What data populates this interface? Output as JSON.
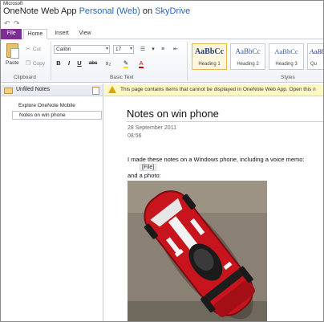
{
  "app": {
    "brand_small": "Microsoft",
    "app_name": "OneNote Web App",
    "notebook_name": "Personal (Web)",
    "on_text": "on",
    "service": "SkyDrive"
  },
  "quick_access": {
    "undo_glyph": "↶",
    "redo_glyph": "↷"
  },
  "tabs": [
    {
      "label": "File"
    },
    {
      "label": "Home"
    },
    {
      "label": "Insert"
    },
    {
      "label": "View"
    }
  ],
  "ribbon": {
    "clipboard": {
      "paste_label": "Paste",
      "cut_label": "Cut",
      "copy_label": "Copy",
      "group_label": "Clipboard"
    },
    "basic_text": {
      "font_name": "Calibri",
      "font_size": "17",
      "bold": "B",
      "italic": "I",
      "underline": "U",
      "strike": "abc",
      "group_label": "Basic Text"
    },
    "styles": {
      "group_label": "Styles",
      "items": [
        {
          "sample": "AaBbCc",
          "name": "Heading 1"
        },
        {
          "sample": "AaBbCc",
          "name": "Heading 2"
        },
        {
          "sample": "AaBbCc",
          "name": "Heading 3"
        },
        {
          "sample": "AaBbCc",
          "name": "Qu"
        }
      ]
    }
  },
  "navigation": {
    "notebook_label": "Unfiled Notes",
    "sections": [
      {
        "label": "Explore OneNote Mobile"
      },
      {
        "label": "Notes on win phone"
      }
    ]
  },
  "infobar": {
    "text": "This page contains items that cannot be displayed in OneNote Web App. Open this n"
  },
  "page": {
    "title": "Notes on win phone",
    "date": "28 September 2011",
    "time": "08:56",
    "line1": "I made these notes on a Windows phone, including a voice memo:",
    "file_chip": "[File]",
    "line2": "and a photo:"
  },
  "colors": {
    "file_tab": "#7b2d91",
    "link_blue": "#2a66b8",
    "infobar_bg": "#fff8c5",
    "car_red": "#c8141c"
  }
}
